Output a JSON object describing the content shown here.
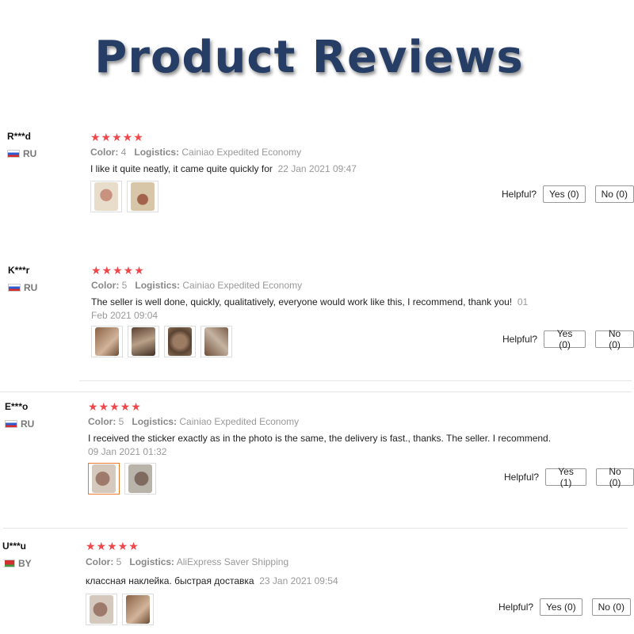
{
  "title": "Product Reviews",
  "colors": {
    "title": "#263d66",
    "stars": "#f0474b",
    "accent_border": "#e87a2a"
  },
  "labels": {
    "color": "Color:",
    "logistics": "Logistics:",
    "helpful": "Helpful?"
  },
  "reviews": [
    {
      "user": "R***d",
      "country": "RU",
      "flag": "russia-flag-icon",
      "stars": "★★★★★",
      "rating": 5,
      "color": "4",
      "logistics": "Cainiao Expedited Economy",
      "text": "I like it quite neatly, it came quite quickly for",
      "date": "22 Jan 2021 09:47",
      "photos": 2,
      "yes": "Yes (0)",
      "no": "No (0)"
    },
    {
      "user": "K***r",
      "country": "RU",
      "flag": "russia-flag-icon",
      "stars": "★★★★★",
      "rating": 5,
      "color": "5",
      "logistics": "Cainiao Expedited Economy",
      "text": "The seller is well done, quickly, qualitatively, everyone would work like this, I recommend, thank you!",
      "date": "01 Feb 2021 09:04",
      "photos": 4,
      "yes": "Yes (0)",
      "no": "No (0)"
    },
    {
      "user": "E***o",
      "country": "RU",
      "flag": "russia-flag-icon",
      "stars": "★★★★★",
      "rating": 5,
      "color": "5",
      "logistics": "Cainiao Expedited Economy",
      "text": "I received the sticker exactly as in the photo is the same, the delivery is fast., thanks. The seller. I recommend.",
      "date": "09 Jan 2021 01:32",
      "photos": 2,
      "yes": "Yes (1)",
      "no": "No (0)"
    },
    {
      "user": "U***u",
      "country": "BY",
      "flag": "belarus-flag-icon",
      "stars": "★★★★★",
      "rating": 5,
      "color": "5",
      "logistics": "AliExpress Saver Shipping",
      "text": "классная наклейка. быстрая доставка",
      "date": "23 Jan 2021 09:54",
      "photos": 2,
      "yes": "Yes (0)",
      "no": "No (0)"
    }
  ]
}
